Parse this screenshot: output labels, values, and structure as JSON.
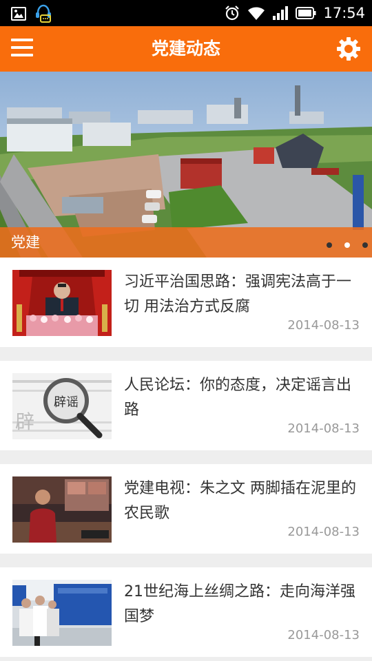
{
  "status_bar": {
    "time": "17:54",
    "icons": [
      "image-icon",
      "chat-bot-icon",
      "alarm-icon",
      "wifi-icon",
      "signal-icon",
      "battery-icon"
    ]
  },
  "app_bar": {
    "title": "党建动态",
    "menu_icon": "menu-icon",
    "settings_icon": "settings-icon",
    "color": "#f96d0c"
  },
  "banner": {
    "caption": "党建",
    "page_count": 3,
    "active_page": 2
  },
  "news": [
    {
      "title": "习近平治国思路：强调宪法高于一切 用法治方式反腐",
      "date": "2014-08-13"
    },
    {
      "title": "人民论坛：你的态度，决定谣言出路",
      "date": "2014-08-13"
    },
    {
      "title": "党建电视：朱之文 两脚插在泥里的农民歌",
      "date": "2014-08-13"
    },
    {
      "title": "21世纪海上丝绸之路：走向海洋强国梦",
      "date": "2014-08-13"
    }
  ],
  "thumbnail_texts": {
    "rumor_sign": "辟谣"
  }
}
